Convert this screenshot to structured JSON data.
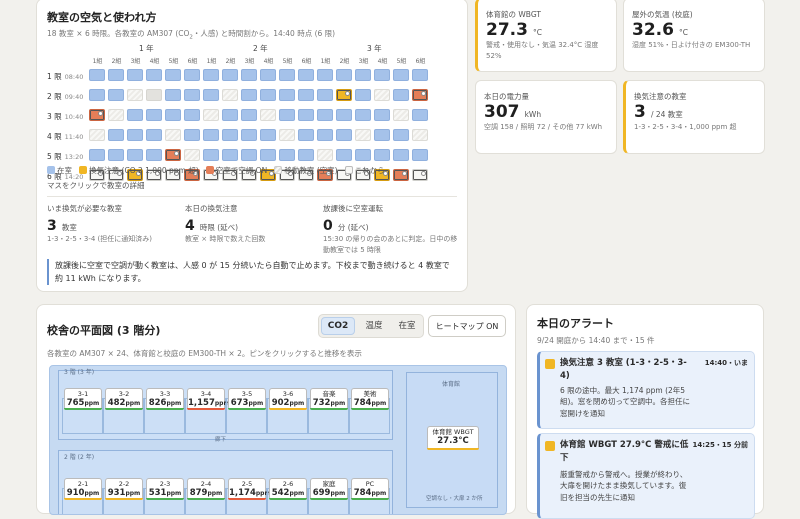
{
  "air": {
    "title": "教室の空気と使われ方",
    "subtitle_pre": "18 教室 × 6 時限。各教室の AM307 (CO",
    "subtitle_sub": "2",
    "subtitle_post": "・人感) と時間割から。14:40 時点 (6 限)",
    "grades": [
      "1 年",
      "2 年",
      "3 年"
    ],
    "classes": [
      "1組",
      "2組",
      "3組",
      "4組",
      "5組",
      "6組",
      "1組",
      "2組",
      "3組",
      "4組",
      "5組",
      "6組",
      "1組",
      "2組",
      "3組",
      "4組",
      "5組",
      "6組"
    ],
    "periods": [
      {
        "label": "1 限",
        "time": "08:40"
      },
      {
        "label": "2 限",
        "time": "09:40"
      },
      {
        "label": "3 限",
        "time": "10:40"
      },
      {
        "label": "4 限",
        "time": "11:40"
      },
      {
        "label": "5 限",
        "time": "13:20"
      },
      {
        "label": "6 限",
        "time": "14:20"
      }
    ],
    "grid": [
      [
        "in",
        "in",
        "in",
        "in",
        "in",
        "in",
        "in",
        "in",
        "in",
        "in",
        "in",
        "in",
        "in",
        "in",
        "in",
        "in",
        "in",
        "in"
      ],
      [
        "in",
        "in",
        "mv",
        "em",
        "in",
        "in",
        "in",
        "mv",
        "in",
        "in",
        "in",
        "in",
        "in",
        "co",
        "in",
        "mv",
        "in",
        "ac"
      ],
      [
        "ac",
        "mv",
        "in",
        "in",
        "in",
        "in",
        "mv",
        "in",
        "in",
        "mv",
        "in",
        "in",
        "in",
        "in",
        "in",
        "in",
        "mv",
        "in"
      ],
      [
        "mv",
        "in",
        "in",
        "in",
        "mv",
        "in",
        "in",
        "in",
        "in",
        "in",
        "mv",
        "in",
        "in",
        "in",
        "mv",
        "in",
        "in",
        "mv"
      ],
      [
        "in",
        "in",
        "in",
        "in",
        "ac",
        "mv",
        "in",
        "in",
        "in",
        "in",
        "in",
        "in",
        "mv",
        "in",
        "in",
        "in",
        "in",
        "in"
      ],
      [
        "ft",
        "ft",
        "co",
        "ft",
        "ft",
        "ac",
        "ft",
        "ft",
        "ft",
        "co",
        "ft",
        "ft",
        "ac",
        "ft",
        "ft",
        "co",
        "ac",
        "ft"
      ]
    ],
    "legend": [
      "在室",
      "換気注意 (CO 2 1,000 ppm 超)",
      "空室で空調 ON",
      "移動教室 (空室)",
      "これから"
    ],
    "hint": "マスをクリックで教室の詳細",
    "stats": [
      {
        "label": "いま換気が必要な教室",
        "value": "3",
        "unit": "教室",
        "detail": "1-3・2-5・3-4 (担任に通知済み)"
      },
      {
        "label": "本日の換気注意",
        "value": "4",
        "unit": "時限 (延べ)",
        "detail": "教室 × 時限で数えた回数"
      },
      {
        "label": "放課後に空室運転",
        "value": "0",
        "unit": "分 (延べ)",
        "detail": "15:30 の帰りの会のあとに判定。日中の移動教室では 5 時限"
      }
    ],
    "note": "放課後に空室で空調が動く教室は、人感 0 が 15 分続いたら自動で止めます。下校まで動き続けると 4 教室で約 11 kWh になります。"
  },
  "kpis": [
    {
      "label": "体育館の WBGT",
      "value": "27.3",
      "unit": "°C",
      "detail": "警戒・使用なし・気温 32.4°C 湿度 52%",
      "warn": true
    },
    {
      "label": "屋外の気温 (校庭)",
      "value": "32.6",
      "unit": "°C",
      "detail": "湿度 51%・日よけ付きの EM300-TH",
      "warn": false
    },
    {
      "label": "本日の電力量",
      "value": "307",
      "unit": "kWh",
      "detail": "空調 158 / 照明 72 / その他 77 kWh",
      "warn": false
    },
    {
      "label": "換気注意の教室",
      "value": "3",
      "unit": "/ 24 教室",
      "detail": "1-3・2-5・3-4・1,000 ppm 超",
      "warn": true
    }
  ],
  "floor": {
    "title": "校舎の平面図 (3 階分)",
    "tabs": [
      "CO2",
      "温度",
      "在室"
    ],
    "active_tab": "CO2",
    "heatmap_btn": "ヒートマップ ON",
    "subtitle": "各教室の AM307 × 24、体育館と校庭の EM300-TH × 2。ピンをクリックすると推移を表示",
    "floor3_label": "3 階 (3 年)",
    "floor2_label": "2 階 (2 年)",
    "corridor": "廊下",
    "gym_label": "体育館",
    "gym_foot": "空調なし・大扉 2 か所",
    "gym_pin_label": "体育館 WBGT",
    "gym_pin_value": "27.3°C",
    "rooms3": [
      {
        "name": "3-1",
        "val": "765",
        "c": "#4caf50"
      },
      {
        "name": "3-2",
        "val": "482",
        "c": "#4caf50"
      },
      {
        "name": "3-3",
        "val": "826",
        "c": "#4caf50"
      },
      {
        "name": "3-4",
        "val": "1,157",
        "c": "#e45b3c"
      },
      {
        "name": "3-5",
        "val": "673",
        "c": "#4caf50"
      },
      {
        "name": "3-6",
        "val": "902",
        "c": "#f0b624"
      },
      {
        "name": "音楽",
        "val": "732",
        "c": "#4caf50"
      },
      {
        "name": "美術",
        "val": "784",
        "c": "#4caf50"
      }
    ],
    "rooms2": [
      {
        "name": "2-1",
        "val": "910",
        "c": "#f0b624"
      },
      {
        "name": "2-2",
        "val": "931",
        "c": "#f0b624"
      },
      {
        "name": "2-3",
        "val": "531",
        "c": "#4caf50"
      },
      {
        "name": "2-4",
        "val": "879",
        "c": "#4caf50"
      },
      {
        "name": "2-5",
        "val": "1,174",
        "c": "#e45b3c"
      },
      {
        "name": "2-6",
        "val": "542",
        "c": "#4caf50"
      },
      {
        "name": "家庭",
        "val": "699",
        "c": "#4caf50"
      },
      {
        "name": "PC",
        "val": "784",
        "c": "#4caf50"
      }
    ],
    "unit": "ppm"
  },
  "alerts": {
    "title": "本日のアラート",
    "subtitle": "9/24 開庭から 14:40 まで・15 件",
    "items": [
      {
        "title": "換気注意 3 教室 (1-3・2-5・3-4)",
        "time": "14:40・いま",
        "body": "6 限の途中。最大 1,174 ppm (2年5組)。窓を閉め切って空調中。各担任に窓開けを通知"
      },
      {
        "title": "体育館 WBGT 27.9°C 警戒に低下",
        "time": "14:25・15 分前",
        "body": "厳重警戒から警戒へ。授業が終わり、大扉を開けたまま換気しています。復旧を担当の先生に通知"
      }
    ]
  },
  "colors": {
    "in": "#a5c2ea",
    "co": "#f0b624",
    "ac": "#e47e58",
    "warn": "#f0b624",
    "ok": "#4caf50",
    "alert": "#e45b3c"
  }
}
